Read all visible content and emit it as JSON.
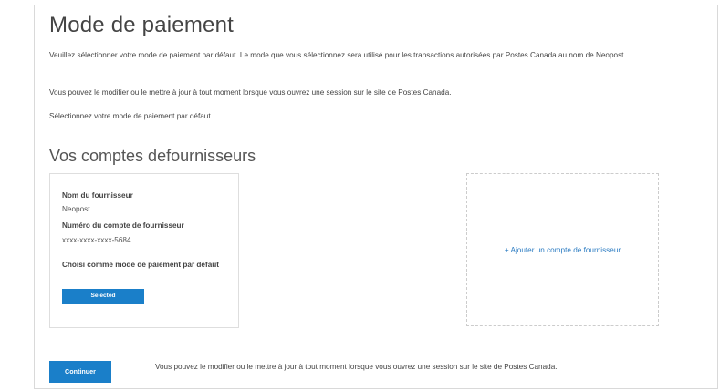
{
  "page": {
    "title": "Mode de paiement",
    "intro": "Veuillez sélectionner votre mode de paiement par défaut. Le mode que vous sélectionnez sera utilisé pour les transactions autorisées par Postes Canada au nom de Neopost",
    "update_note": "Vous pouvez le modifier ou le mettre à jour à tout moment lorsque vous ouvrez une session sur le site de Postes Canada.",
    "select_instruction": "Sélectionnez votre mode de paiement par défaut"
  },
  "suppliers": {
    "section_title": "Vos comptes defournisseurs",
    "card": {
      "supplier_name_label": "Nom du fournisseur",
      "supplier_name_value": "Neopost",
      "account_number_label": "Numéro du compte de fournisseur",
      "account_number_value": "xxxx-xxxx-xxxx-5684",
      "default_label": "Choisi comme mode de paiement par défaut",
      "selected_button": "Selected"
    },
    "add_account_link": "+ Ajouter un compte de fournisseur"
  },
  "footer": {
    "continue_button": "Continuer",
    "note": "Vous pouvez le modifier ou le mettre à jour à tout moment lorsque vous ouvrez une session sur le site de Postes Canada."
  },
  "colors": {
    "primary": "#1a7fc9",
    "link": "#2a7bc2"
  }
}
